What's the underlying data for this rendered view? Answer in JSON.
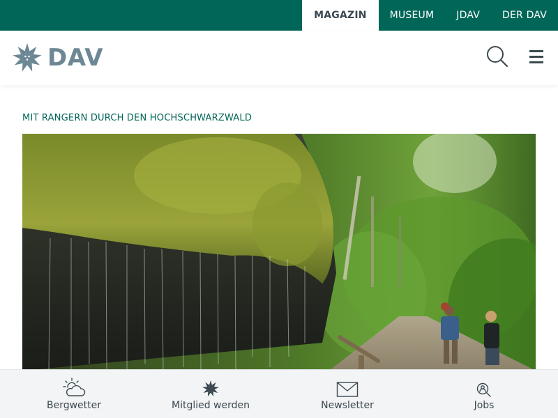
{
  "topnav": {
    "items": [
      {
        "label": "MAGAZIN",
        "active": true
      },
      {
        "label": "MUSEUM",
        "active": false
      },
      {
        "label": "JDAV",
        "active": false
      },
      {
        "label": "DER DAV",
        "active": false
      }
    ]
  },
  "header": {
    "logo_text": "DAV",
    "search_icon": "search-icon",
    "menu_icon": "hamburger-menu-icon"
  },
  "article": {
    "kicker": "MIT RANGERN DURCH DEN HOCHSCHWARZWALD"
  },
  "bottombar": {
    "items": [
      {
        "label": "Bergwetter",
        "icon": "cloud-sun-icon"
      },
      {
        "label": "Mitglied werden",
        "icon": "edelweiss-icon"
      },
      {
        "label": "Newsletter",
        "icon": "envelope-icon"
      },
      {
        "label": "Jobs",
        "icon": "search-person-icon"
      }
    ]
  },
  "colors": {
    "brand_green": "#006658",
    "logo_gray": "#6d8894",
    "text_dark": "#3c4850"
  }
}
